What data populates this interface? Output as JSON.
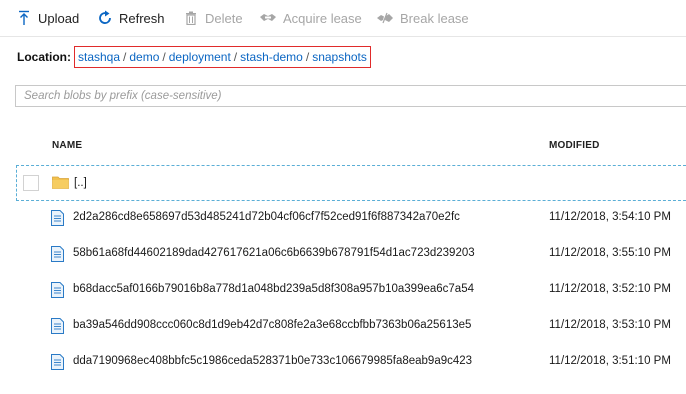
{
  "toolbar": {
    "upload": "Upload",
    "refresh": "Refresh",
    "delete": "Delete",
    "acquire_lease": "Acquire lease",
    "break_lease": "Break lease"
  },
  "location": {
    "label": "Location:",
    "crumbs": [
      "stashqa",
      "demo",
      "deployment",
      "stash-demo",
      "snapshots"
    ],
    "separator": "/"
  },
  "search": {
    "placeholder": "Search blobs by prefix (case-sensitive)"
  },
  "table": {
    "columns": {
      "name": "NAME",
      "modified": "MODIFIED"
    },
    "parent": {
      "name": "[..]"
    },
    "rows": [
      {
        "name": "2d2a286cd8e658697d53d485241d72b04cf06cf7f52ced91f6f887342a70e2fc",
        "modified": "11/12/2018, 3:54:10 PM"
      },
      {
        "name": "58b61a68fd44602189dad427617621a06c6b6639b678791f54d1ac723d239203",
        "modified": "11/12/2018, 3:55:10 PM"
      },
      {
        "name": "b68dacc5af0166b79016b8a778d1a048bd239a5d8f308a957b10a399ea6c7a54",
        "modified": "11/12/2018, 3:52:10 PM"
      },
      {
        "name": "ba39a546dd908ccc060c8d1d9eb42d7c808fe2a3e68ccbfbb7363b06a25613e5",
        "modified": "11/12/2018, 3:53:10 PM"
      },
      {
        "name": "dda7190968ec408bbfc5c1986ceda528371b0e733c106679985fa8eab9a9c423",
        "modified": "11/12/2018, 3:51:10 PM"
      }
    ]
  },
  "colors": {
    "link": "#0b66c3",
    "highlight_border": "#e02b2b",
    "icon_blue": "#0b66c3",
    "disabled": "#a6a6a6",
    "folder": "#f2c14e"
  },
  "icons": {
    "upload": "upload-arrow-icon",
    "refresh": "refresh-icon",
    "delete": "trash-icon",
    "acquire_lease": "acquire-lease-icon",
    "break_lease": "break-lease-icon",
    "folder": "folder-icon",
    "file": "file-icon"
  }
}
